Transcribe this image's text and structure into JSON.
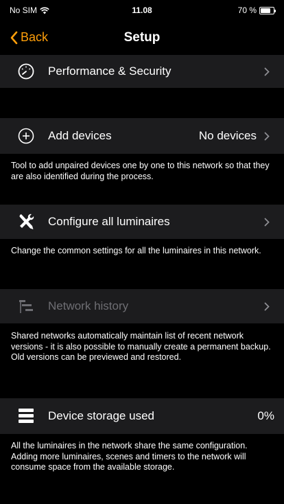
{
  "status_bar": {
    "carrier": "No SIM",
    "time": "11.08",
    "battery": "70 %"
  },
  "nav": {
    "back_label": "Back",
    "title": "Setup"
  },
  "rows": {
    "performance": {
      "label": "Performance & Security",
      "icon": "gauge-icon"
    },
    "add_devices": {
      "label": "Add devices",
      "value": "No devices",
      "icon": "plus-circle-icon",
      "description": "Tool to add unpaired devices one by one to this network so that they are also identified during the process."
    },
    "configure": {
      "label": "Configure all luminaires",
      "icon": "tools-icon",
      "description": "Change the common settings for all the luminaires in this network."
    },
    "history": {
      "label": "Network history",
      "icon": "history-icon",
      "description": "Shared networks automatically maintain list of recent network versions - it is also possible to manually create a permanent backup. Old versions can be previewed and restored."
    },
    "storage": {
      "label": "Device storage used",
      "value": "0%",
      "icon": "storage-icon",
      "description": "All the luminaires in the network share the same configuration. Adding more luminaires, scenes and timers to the network will consume space from the available storage."
    }
  },
  "colors": {
    "accent": "#ff9f0a",
    "row_bg": "#1c1c1e",
    "background": "#000000",
    "disabled_text": "#6e6e73"
  }
}
